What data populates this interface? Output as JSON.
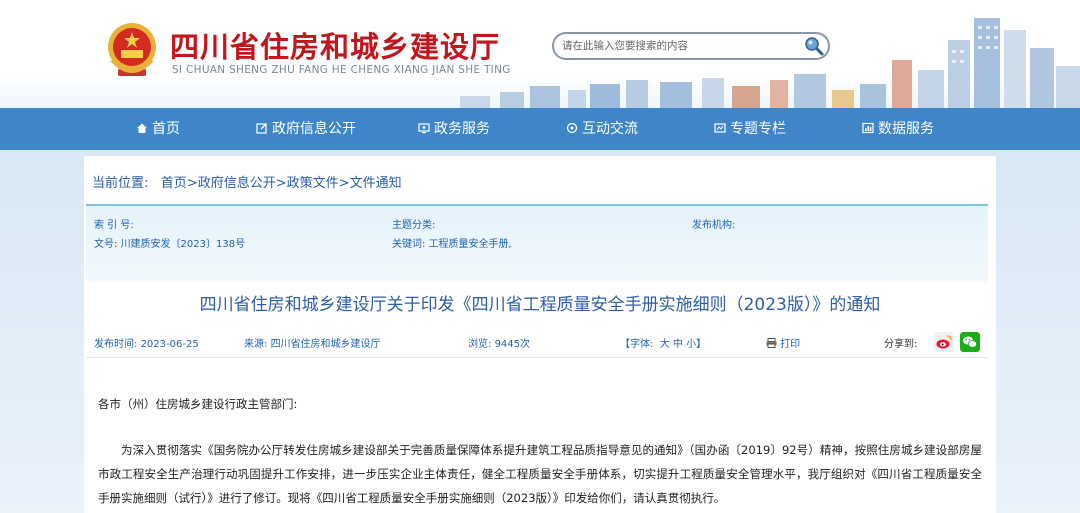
{
  "header": {
    "title": "四川省住房和城乡建设厅",
    "pinyin": "SI CHUAN SHENG ZHU FANG HE CHENG XIANG JIAN SHE TING",
    "search": {
      "placeholder": "请在此输入您要搜索的内容"
    }
  },
  "nav": {
    "items": [
      {
        "label": "首页",
        "icon": "home-icon"
      },
      {
        "label": "政府信息公开",
        "icon": "edit-icon"
      },
      {
        "label": "政务服务",
        "icon": "service-icon"
      },
      {
        "label": "互动交流",
        "icon": "interact-icon"
      },
      {
        "label": "专题专栏",
        "icon": "column-icon"
      },
      {
        "label": "数据服务",
        "icon": "data-icon"
      }
    ]
  },
  "breadcrumb": {
    "label": "当前位置:",
    "items": [
      "首页",
      "政府信息公开",
      "政策文件",
      "文件通知"
    ],
    "sep": ">"
  },
  "meta": {
    "index_label": "索 引 号:",
    "index_value": "",
    "topic_label": "主题分类:",
    "topic_value": "",
    "org_label": "发布机构:",
    "org_value": "",
    "docno_label": "文号:",
    "docno_value": "川建质安发〔2023〕138号",
    "keywords_label": "关键词:",
    "keywords_value": "工程质量安全手册,"
  },
  "article": {
    "title": "四川省住房和城乡建设厅关于印发《四川省工程质量安全手册实施细则（2023版）》的通知",
    "publish_label": "发布时间:",
    "publish_date": "2023-06-25",
    "source_label": "来源:",
    "source": "四川省住房和城乡建设厅",
    "views_label": "浏览:",
    "views": "9445次",
    "font_label": "【字体:",
    "font_large": "大",
    "font_medium": "中",
    "font_small": "小",
    "font_close": "】",
    "print_label": "打印",
    "share_label": "分享到:",
    "salutation": "各市（州）住房城乡建设行政主管部门:",
    "paragraph": "为深入贯彻落实《国务院办公厅转发住房城乡建设部关于完善质量保障体系提升建筑工程品质指导意见的通知》（国办函〔2019〕92号）精神，按照住房城乡建设部房屋市政工程安全生产治理行动巩固提升工作安排，进一步压实企业主体责任，健全工程质量安全手册体系，切实提升工程质量安全管理水平，我厅组织对《四川省工程质量安全手册实施细则（试行）》进行了修订。现将《四川省工程质量安全手册实施细则（2023版）》印发给你们，请认真贯彻执行。"
  },
  "colors": {
    "nav": "#3e86c7",
    "title_red": "#c2161d",
    "link_blue": "#2a5caa"
  }
}
